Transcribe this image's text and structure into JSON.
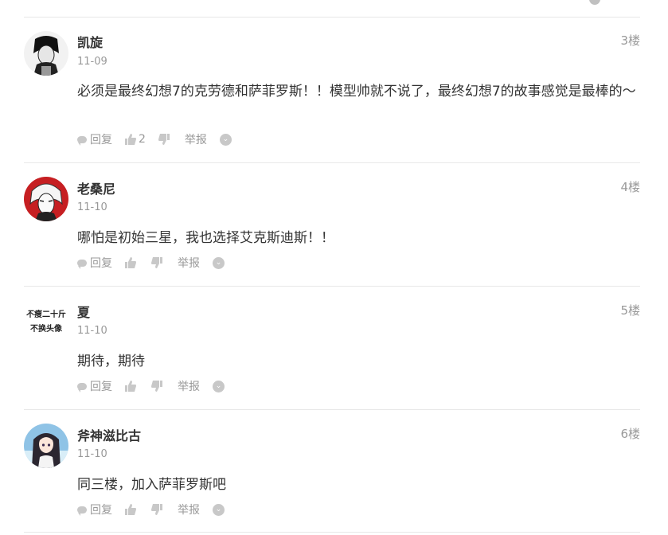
{
  "comments": [
    {
      "name": "凯旋",
      "floor": "3楼",
      "date": "11-09",
      "text": "必须是最终幻想7的克劳德和萨菲罗斯！！模型帅就不说了，最终幻想7的故事感觉是最棒的～",
      "reply_label": "回复",
      "like_count": "2",
      "report_label": "举报"
    },
    {
      "name": "老桑尼",
      "floor": "4楼",
      "date": "11-10",
      "text": "哪怕是初始三星，我也选择艾克斯迪斯！！",
      "reply_label": "回复",
      "like_count": "",
      "report_label": "举报"
    },
    {
      "name": "夏",
      "floor": "5楼",
      "date": "11-10",
      "text": "期待，期待",
      "reply_label": "回复",
      "like_count": "",
      "report_label": "举报",
      "avatar_text_line1": "不瘦二十斤",
      "avatar_text_line2": "不换头像"
    },
    {
      "name": "斧神滋比古",
      "floor": "6楼",
      "date": "11-10",
      "text": "同三楼，加入萨菲罗斯吧",
      "reply_label": "回复",
      "like_count": "",
      "report_label": "举报"
    }
  ],
  "colors": {
    "text": "#333333",
    "muted": "#999999",
    "icon": "#c8c8c8",
    "divider": "#e8e8e8"
  }
}
